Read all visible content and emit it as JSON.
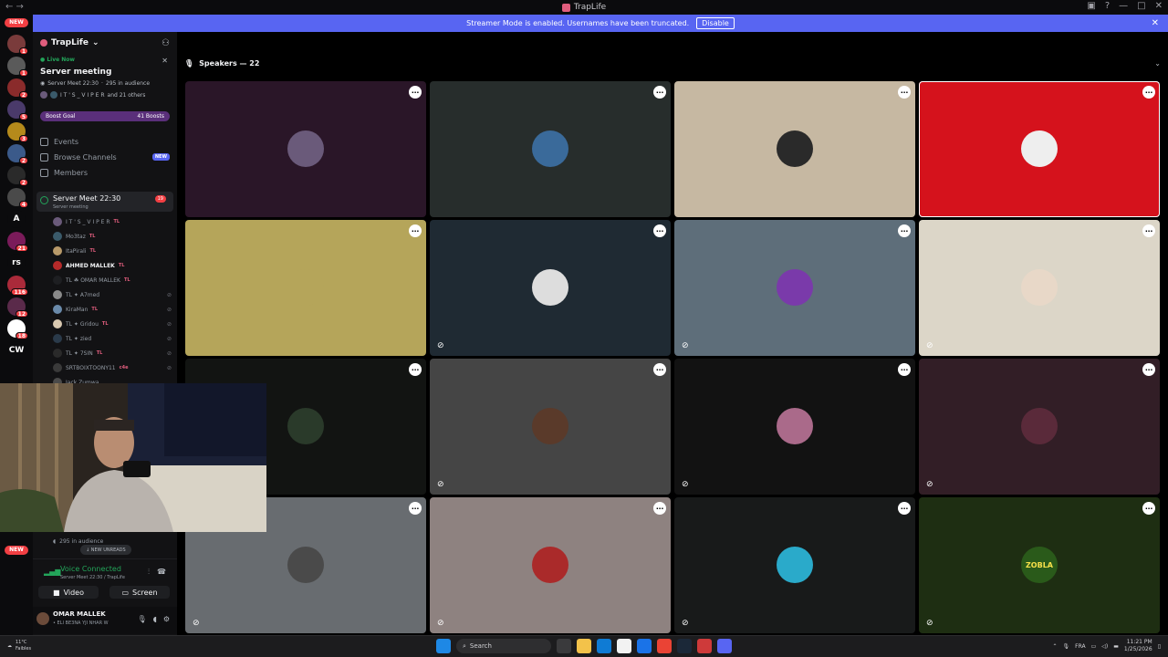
{
  "window": {
    "title": "TrapLife"
  },
  "banner": {
    "text": "Streamer Mode is enabled. Usernames have been truncated.",
    "button": "Disable"
  },
  "guilds": {
    "new_top": "NEW",
    "new_bottom": "NEW",
    "items": [
      {
        "label": "",
        "color": "#7a3b3b",
        "badge": "1"
      },
      {
        "label": "",
        "color": "#5a5a5a",
        "badge": "1"
      },
      {
        "label": "",
        "color": "#8a2b2b",
        "badge": "2"
      },
      {
        "label": "",
        "color": "#4a3a6a",
        "badge": "5"
      },
      {
        "label": "",
        "color": "#b58a1b",
        "badge": "3"
      },
      {
        "label": "",
        "color": "#3b5a8a",
        "badge": "2"
      },
      {
        "label": "",
        "color": "#2a2a2a",
        "badge": "2"
      },
      {
        "label": "",
        "color": "#4a4a4a",
        "badge": "4"
      },
      {
        "label": "A",
        "color": "#0b0b0d",
        "badge": ""
      },
      {
        "label": "",
        "color": "#7a1b5a",
        "badge": "21"
      },
      {
        "label": "rs",
        "color": "#0b0b0d",
        "badge": ""
      },
      {
        "label": "",
        "color": "#aa2a3a",
        "badge": "116"
      },
      {
        "label": "",
        "color": "#5a2a4a",
        "badge": "12"
      },
      {
        "label": "",
        "color": "#ffffff",
        "badge": "18"
      },
      {
        "label": "CW",
        "color": "#0b0b0d",
        "badge": ""
      }
    ]
  },
  "sidebar": {
    "server_name": "TrapLife",
    "live": "Live Now",
    "event_title": "Server meeting",
    "event_meta": "Server Meet 22:30",
    "event_audience": "295 in audience",
    "event_people_name": "I T ' S _ V I P E R",
    "event_people_more": "and 21 others",
    "boost_label": "Boost Goal",
    "boost_count": "41 Boosts",
    "nav": [
      {
        "label": "Events",
        "tag": ""
      },
      {
        "label": "Browse Channels",
        "tag": "NEW"
      },
      {
        "label": "Members",
        "tag": ""
      }
    ],
    "voice_channel": {
      "name": "Server Meet 22:30",
      "sub": "Server meeting",
      "count": "19"
    },
    "members": [
      {
        "name": "I T ' S _ V I P E R",
        "tag": "TL",
        "muted": false,
        "bold": false,
        "color": "#6a5a7a"
      },
      {
        "name": "Mo3taz",
        "tag": "TL",
        "muted": false,
        "bold": false,
        "color": "#3a5a6a"
      },
      {
        "name": "ItaPirali",
        "tag": "TL",
        "muted": false,
        "bold": false,
        "color": "#b89a6a"
      },
      {
        "name": "AHMED MALLEK",
        "tag": "TL",
        "muted": false,
        "bold": true,
        "color": "#b52a2a"
      },
      {
        "name": "TL ☘ OMAR MALLEK",
        "tag": "TL",
        "muted": false,
        "bold": false,
        "color": "#1e1f22"
      },
      {
        "name": "TL ✦ A7med",
        "tag": "",
        "muted": true,
        "bold": false,
        "color": "#8a8a8a"
      },
      {
        "name": "KiraMan",
        "tag": "TL",
        "muted": true,
        "bold": false,
        "color": "#6a8aaa"
      },
      {
        "name": "TL ✦ Gridou",
        "tag": "TL",
        "muted": true,
        "bold": false,
        "color": "#d8c8b0"
      },
      {
        "name": "TL ✦ zied",
        "tag": "",
        "muted": true,
        "bold": false,
        "color": "#2a3a4a"
      },
      {
        "name": "TL ✦ 7SIN",
        "tag": "TL",
        "muted": true,
        "bold": false,
        "color": "#2a2a2a"
      },
      {
        "name": "SRTBOIXTOONY11",
        "tag": "c4e",
        "muted": true,
        "bold": false,
        "color": "#3a3a3a"
      },
      {
        "name": "Jack Zumwa",
        "tag": "",
        "muted": false,
        "bold": false,
        "color": "#4a4a4a"
      }
    ],
    "audience": "295 in audience",
    "new_unreads": "NEW UNREADS",
    "voice_status": "Voice Connected",
    "voice_sub": "Server Meet 22:30 / TrapLife",
    "video_btn": "Video",
    "screen_btn": "Screen",
    "user_name": "OMAR MALLEK",
    "user_status": "• ELI BE3NA YJI NHAR W"
  },
  "main": {
    "speakers_label": "Speakers — 22",
    "tiles": [
      {
        "bg": "#2a1628",
        "avatar": "#6a5a7a",
        "glyph": "●",
        "muted": false,
        "speaking": false
      },
      {
        "bg": "#272d2c",
        "avatar": "#3a6a9a",
        "glyph": "●",
        "muted": false,
        "speaking": false
      },
      {
        "bg": "#c6b8a2",
        "avatar": "#2a2a2a",
        "glyph": "●",
        "muted": false,
        "speaking": false
      },
      {
        "bg": "#d5121c",
        "avatar": "#eeeeee",
        "glyph": "●",
        "muted": false,
        "speaking": true
      },
      {
        "bg": "#b5a55a",
        "avatar": "#b5a55a",
        "glyph": "✿",
        "muted": false,
        "speaking": false
      },
      {
        "bg": "#1f2a33",
        "avatar": "#dddddd",
        "glyph": "●",
        "muted": true,
        "speaking": false
      },
      {
        "bg": "#5e6e7a",
        "avatar": "#7a3aaa",
        "glyph": "●",
        "muted": true,
        "speaking": false
      },
      {
        "bg": "#dcd6c8",
        "avatar": "#e8d8c8",
        "glyph": "●",
        "muted": true,
        "speaking": false
      },
      {
        "bg": "#121412",
        "avatar": "#2a3a2a",
        "glyph": "●",
        "muted": false,
        "speaking": false
      },
      {
        "bg": "#454545",
        "avatar": "#5a3a2a",
        "glyph": "●",
        "muted": true,
        "speaking": false
      },
      {
        "bg": "#121212",
        "avatar": "#aa6a8a",
        "glyph": "●",
        "muted": true,
        "speaking": false
      },
      {
        "bg": "#321e26",
        "avatar": "#5a2a3a",
        "glyph": "●",
        "muted": true,
        "speaking": false
      },
      {
        "bg": "#686c70",
        "avatar": "#4a4a4a",
        "glyph": "●",
        "muted": true,
        "speaking": false
      },
      {
        "bg": "#8e8280",
        "avatar": "#aa2a2a",
        "glyph": "●",
        "muted": true,
        "speaking": false
      },
      {
        "bg": "#181a1a",
        "avatar": "#2aaaca",
        "glyph": "●",
        "muted": true,
        "speaking": false
      },
      {
        "bg": "#1e2e12",
        "avatar": "#2a5a1a",
        "glyph": "ZOBLA",
        "muted": true,
        "speaking": false
      }
    ]
  },
  "taskbar": {
    "weather_temp": "11°C",
    "weather_text": "Faibles",
    "search": "Search",
    "lang": "FRA",
    "time": "11:21 PM",
    "date": "1/25/2026"
  }
}
